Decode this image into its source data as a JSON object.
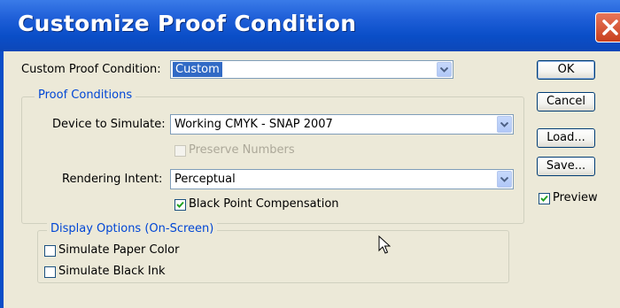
{
  "window": {
    "title": "Customize Proof Condition"
  },
  "custom_condition": {
    "label": "Custom Proof Condition:",
    "value": "Custom"
  },
  "proof_conditions": {
    "legend": "Proof Conditions",
    "device_label": "Device to Simulate:",
    "device_value": "Working CMYK - SNAP 2007",
    "preserve_numbers": {
      "label": "Preserve Numbers",
      "checked": false,
      "enabled": false
    },
    "intent_label": "Rendering Intent:",
    "intent_value": "Perceptual",
    "black_point": {
      "label": "Black Point Compensation",
      "checked": true
    }
  },
  "display_options": {
    "legend": "Display Options (On-Screen)",
    "paper_color": {
      "label": "Simulate Paper Color",
      "checked": false
    },
    "black_ink": {
      "label": "Simulate Black Ink",
      "checked": false
    }
  },
  "buttons": {
    "ok": "OK",
    "cancel": "Cancel",
    "load": "Load...",
    "save": "Save..."
  },
  "preview": {
    "label": "Preview",
    "checked": true
  },
  "colors": {
    "title_bar": "#0a4ec8",
    "selection": "#316ac5",
    "legend_text": "#0046d5",
    "dialog_bg": "#ECE9D8"
  }
}
